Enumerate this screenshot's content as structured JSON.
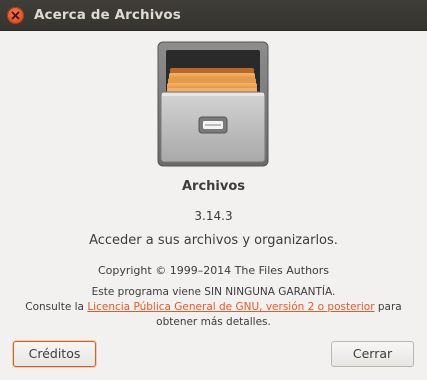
{
  "window": {
    "title": "Acerca de Archivos"
  },
  "icons": {
    "close": "close-icon",
    "app": "file-cabinet-icon"
  },
  "about": {
    "app_name": "Archivos",
    "version": "3.14.3",
    "comments": "Acceder a sus archivos y organizarlos.",
    "copyright": "Copyright © 1999–2014 The Files Authors",
    "license_line1": "Este programa viene SIN NINGUNA GARANTÍA.",
    "license_line2_prefix": "Consulte la ",
    "license_link": "Licencia Pública General de GNU, versión 2 o posterior",
    "license_line2_suffix": " para",
    "license_line3": "obtener más detalles."
  },
  "buttons": {
    "credits": "Créditos",
    "close": "Cerrar"
  },
  "colors": {
    "accent": "#e95420",
    "titlebar": "#3c3b37",
    "background": "#f2f1f0"
  }
}
